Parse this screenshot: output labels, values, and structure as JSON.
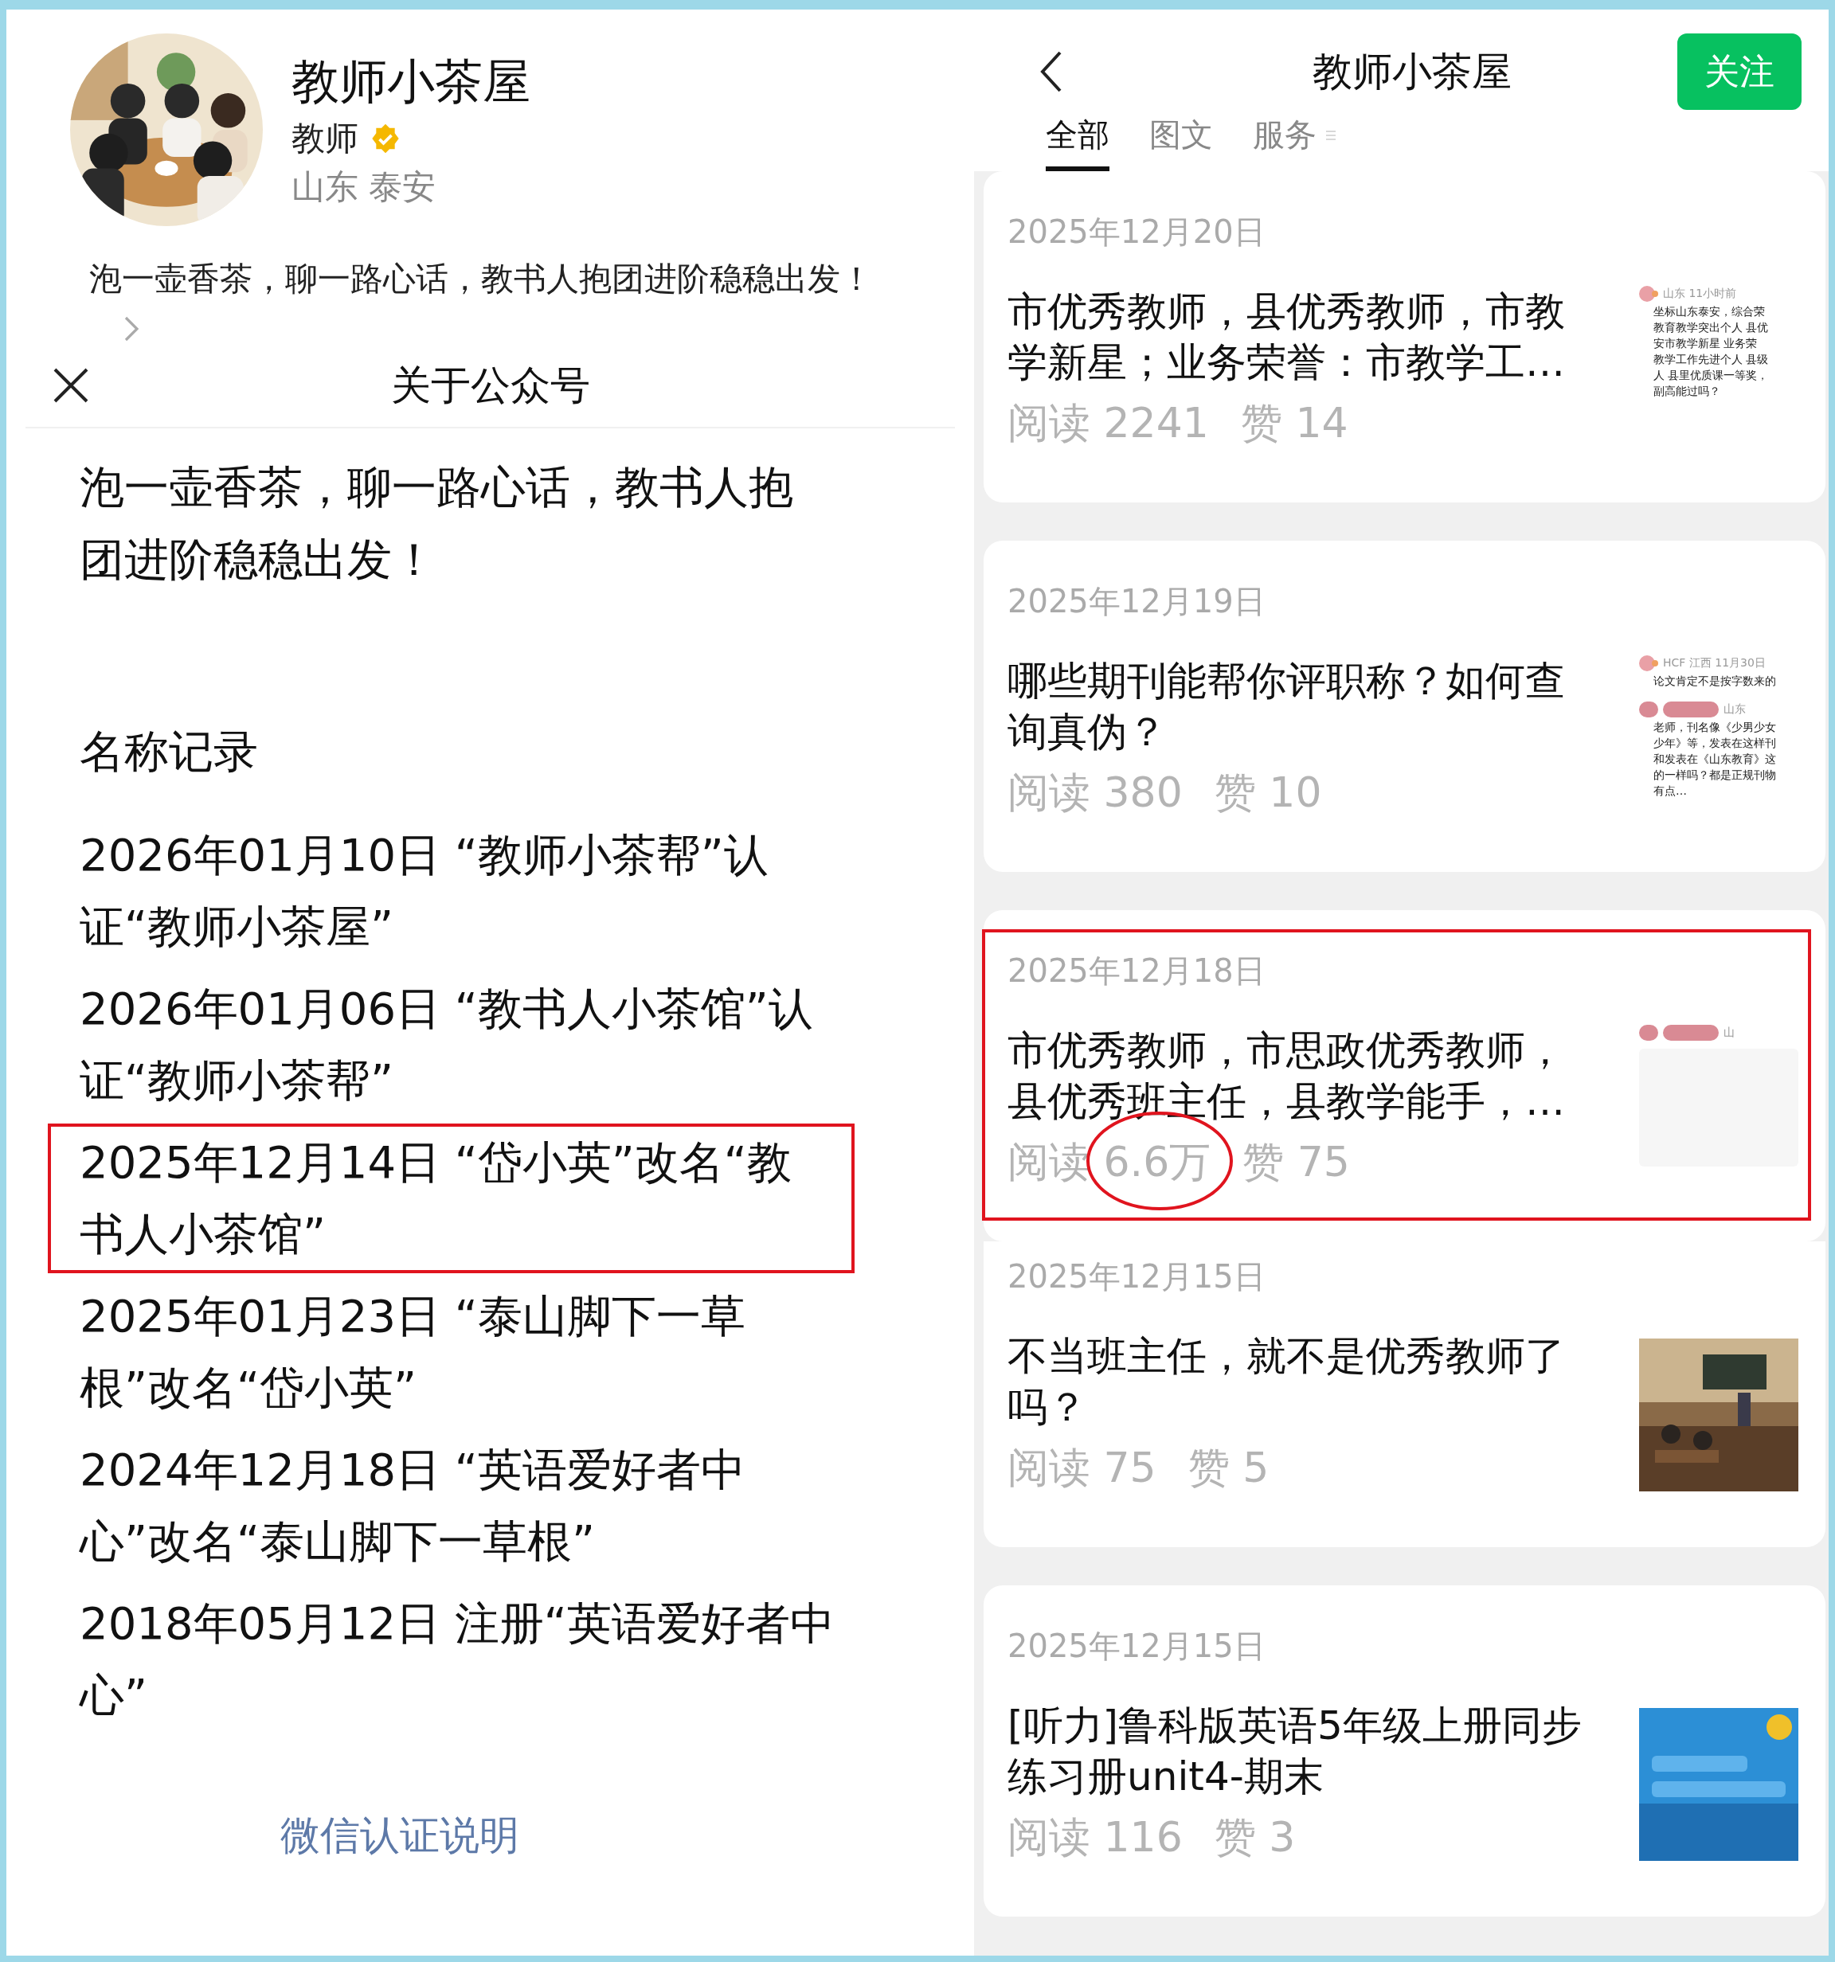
{
  "profile": {
    "name": "教师小茶屋",
    "role": "教师",
    "verified": true,
    "location": "山东 泰安",
    "bio": "泡一壶香茶，聊一路心话，教书人抱团进阶稳稳出发！"
  },
  "about": {
    "title": "关于公众号",
    "description": "泡一壶香茶，聊一路心话，教书人抱团进阶稳稳出发！",
    "history_title": "名称记录",
    "history": [
      {
        "text": "2026年01月10日 “教师小茶帮”认证“教师小茶屋”",
        "highlighted": false
      },
      {
        "text": "2026年01月06日 “教书人小茶馆”认证“教师小茶帮”",
        "highlighted": false
      },
      {
        "text": "2025年12月14日 “岱小英”改名“教书人小茶馆”",
        "highlighted": true
      },
      {
        "text": "2025年01月23日 “泰山脚下一草根”改名“岱小英”",
        "highlighted": false
      },
      {
        "text": "2024年12月18日 “英语爱好者中心”改名“泰山脚下一草根”",
        "highlighted": false
      },
      {
        "text": "2018年05月12日 注册“英语爱好者中心”",
        "highlighted": false
      }
    ],
    "link": "微信认证说明"
  },
  "account": {
    "title": "教师小茶屋",
    "follow_button": "关注",
    "tabs": [
      {
        "label": "全部",
        "selected": true
      },
      {
        "label": "图文",
        "selected": false
      },
      {
        "label": "服务",
        "selected": false
      }
    ],
    "articles": [
      {
        "date": "2025年12月20日",
        "title": "市优秀教师，县优秀教师，市教学新星；业务荣誉：市教学工…",
        "reads": "阅读 2241",
        "likes": "赞 14",
        "highlighted": false,
        "reads_circled": false,
        "joined": false,
        "thumbnail": {
          "kind": "comment",
          "covered": false,
          "comments": [
            {
              "masked": false,
              "meta": "山东 11小时前",
              "lines": [
                "坐标山东泰安，综合荣",
                "教育教学突出个人 县优",
                "安市教学新星  业务荣",
                "教学工作先进个人 县级",
                "人  县里优质课一等奖，",
                "副高能过吗？"
              ]
            }
          ]
        }
      },
      {
        "date": "2025年12月19日",
        "title": "哪些期刊能帮你评职称？如何查询真伪？",
        "reads": "阅读 380",
        "likes": "赞 10",
        "highlighted": false,
        "reads_circled": false,
        "joined": false,
        "thumbnail": {
          "kind": "comment",
          "covered": false,
          "comments": [
            {
              "masked": false,
              "meta": "HCF 江西 11月30日",
              "lines": [
                "论文肯定不是按字数来的"
              ]
            },
            {
              "masked": true,
              "meta": "山东",
              "lines": [
                "老师，刊名像《少男少女",
                "少年》等，发表在这样刊",
                "和发表在《山东教育》这",
                "的一样吗？都是正规刊物",
                "有点…"
              ]
            }
          ]
        }
      },
      {
        "date": "2025年12月18日",
        "title": "市优秀教师，市思政优秀教师，县优秀班主任，县教学能手，…",
        "reads": "阅读 6.6万",
        "likes": "赞 75",
        "highlighted": true,
        "reads_circled": true,
        "joined": false,
        "thumbnail": {
          "kind": "comment",
          "covered": true,
          "comments": [
            {
              "masked": true,
              "meta": "山"
            }
          ]
        }
      },
      {
        "date": "2025年12月15日",
        "title": "不当班主任，就不是优秀教师了吗？",
        "reads": "阅读 75",
        "likes": "赞 5",
        "highlighted": false,
        "reads_circled": false,
        "joined": true
      },
      {
        "date": "2025年12月15日",
        "title": "[听力]鲁科版英语5年级上册同步练习册unit4-期末",
        "reads": "阅读 116",
        "likes": "赞 3",
        "highlighted": false,
        "reads_circled": false,
        "joined": false
      }
    ]
  }
}
